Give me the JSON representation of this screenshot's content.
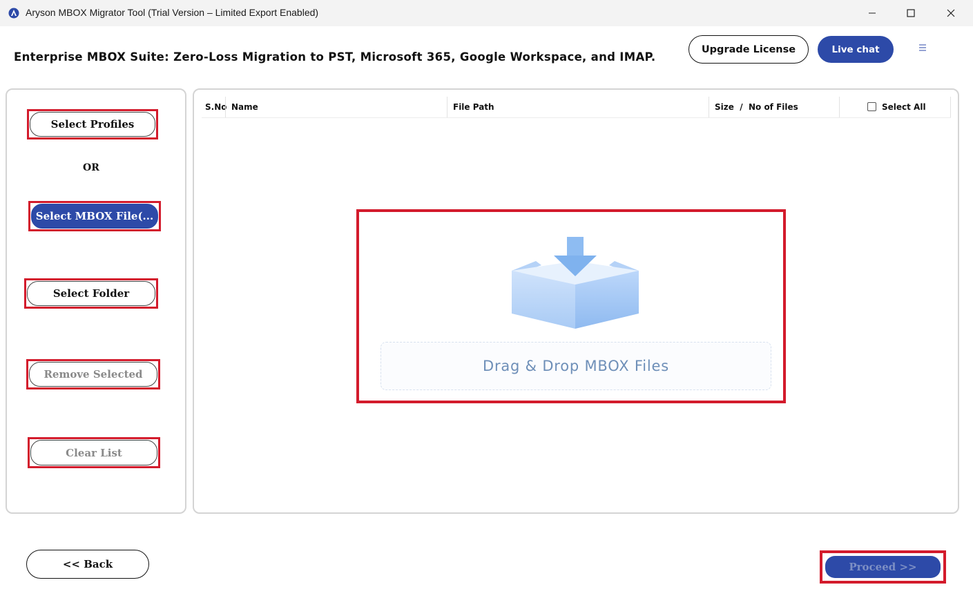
{
  "window": {
    "title": "Aryson MBOX Migrator Tool (Trial Version – Limited Export Enabled)"
  },
  "header": {
    "headline": "Enterprise MBOX Suite: Zero-Loss Migration to PST, Microsoft 365, Google Workspace, and IMAP.",
    "upgrade_label": "Upgrade License",
    "live_chat_label": "Live chat",
    "menu_icon": "hamburger-icon"
  },
  "sidebar": {
    "select_profiles": "Select Profiles",
    "or_label": "OR",
    "select_mbox": "Select MBOX File(...",
    "select_folder": "Select Folder",
    "remove_selected": "Remove Selected",
    "clear_list": "Clear List"
  },
  "table": {
    "columns": [
      "S.No",
      "Name",
      "File Path",
      "Size  /  No of Files"
    ],
    "select_all_label": "Select All",
    "rows": []
  },
  "drop_zone": {
    "text": "Drag & Drop MBOX Files",
    "icon": "box-download-icon"
  },
  "footer": {
    "back_label": "<< Back",
    "proceed_label": "Proceed >>"
  },
  "colors": {
    "accent": "#2d4aa8",
    "highlight": "#d31b2c",
    "drop_text": "#6e8fb8"
  }
}
